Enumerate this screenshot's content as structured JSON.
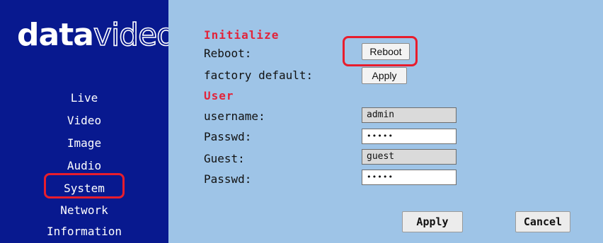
{
  "brand": {
    "bold": "data",
    "thin": "video"
  },
  "sidebar": {
    "items": [
      {
        "label": "Live"
      },
      {
        "label": "Video"
      },
      {
        "label": "Image"
      },
      {
        "label": "Audio"
      },
      {
        "label": "System"
      },
      {
        "label": "Network"
      },
      {
        "label": "Information"
      }
    ],
    "active": "System"
  },
  "initialize": {
    "heading": "Initialize",
    "reboot_label": "Reboot:",
    "reboot_button": "Reboot",
    "factory_label": "factory default:",
    "factory_button": "Apply"
  },
  "user": {
    "heading": "User",
    "username_label": "username:",
    "username_value": "admin",
    "passwd1_label": "Passwd:",
    "passwd1_value": "•••••",
    "guest_label": "Guest:",
    "guest_value": "guest",
    "passwd2_label": "Passwd:",
    "passwd2_value": "•••••"
  },
  "actions": {
    "apply": "Apply",
    "cancel": "Cancel"
  },
  "colors": {
    "sidebar_bg": "#08198f",
    "main_bg": "#9ec4e7",
    "section_heading": "#e2233a",
    "highlight": "#e81d2d"
  }
}
